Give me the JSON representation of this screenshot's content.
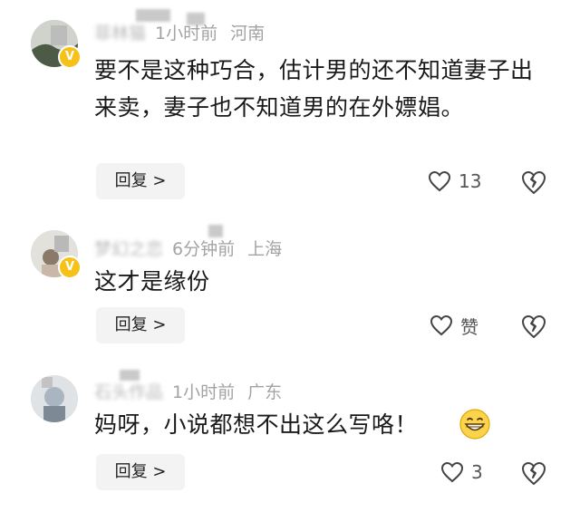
{
  "comments": [
    {
      "username": "菲林猫",
      "time": "1小时前",
      "location": "河南",
      "text": "要不是这种巧合，估计男的还不知道妻子出来卖，妻子也不知道男的在外嫖娼。",
      "reply_label": "回复 >",
      "likes": "13",
      "verified_badge": "V",
      "icons": [
        "heart-icon",
        "broken-heart-icon"
      ]
    },
    {
      "username": "梦幻之恋",
      "time": "6分钟前",
      "location": "上海",
      "text": "这才是缘份",
      "reply_label": "回复 >",
      "likes": "赞",
      "verified_badge": "V",
      "icons": [
        "heart-icon",
        "broken-heart-icon"
      ]
    },
    {
      "username": "石头作品",
      "time": "1小时前",
      "location": "广东",
      "text": "妈呀，小说都想不出这么写咯！",
      "reply_label": "回复 >",
      "likes": "3",
      "emoji": "grinning-face-emoji",
      "icons": [
        "heart-icon",
        "broken-heart-icon"
      ]
    }
  ],
  "colors": {
    "meta_text": "#a3a3a3",
    "body_text": "#1a1a1a",
    "reply_bg": "#f3f3f3",
    "badge": "#f6c21a"
  }
}
